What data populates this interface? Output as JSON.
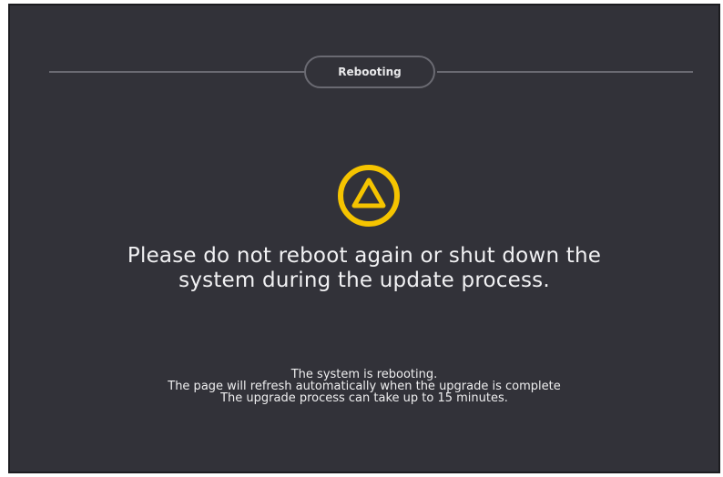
{
  "header": {
    "status_label": "Rebooting"
  },
  "icon": {
    "name": "warning-triangle-icon",
    "color": "#F5C400"
  },
  "message": {
    "line1": "Please do not reboot again or shut down the",
    "line2": "system during the update process."
  },
  "details": {
    "line1": "The system is rebooting.",
    "line2": "The page will refresh automatically when the upgrade is complete",
    "line3": "The upgrade process can take up to 15 minutes."
  },
  "colors": {
    "background": "#323239",
    "text": "#F1F1F3",
    "accent": "#F5C400"
  }
}
